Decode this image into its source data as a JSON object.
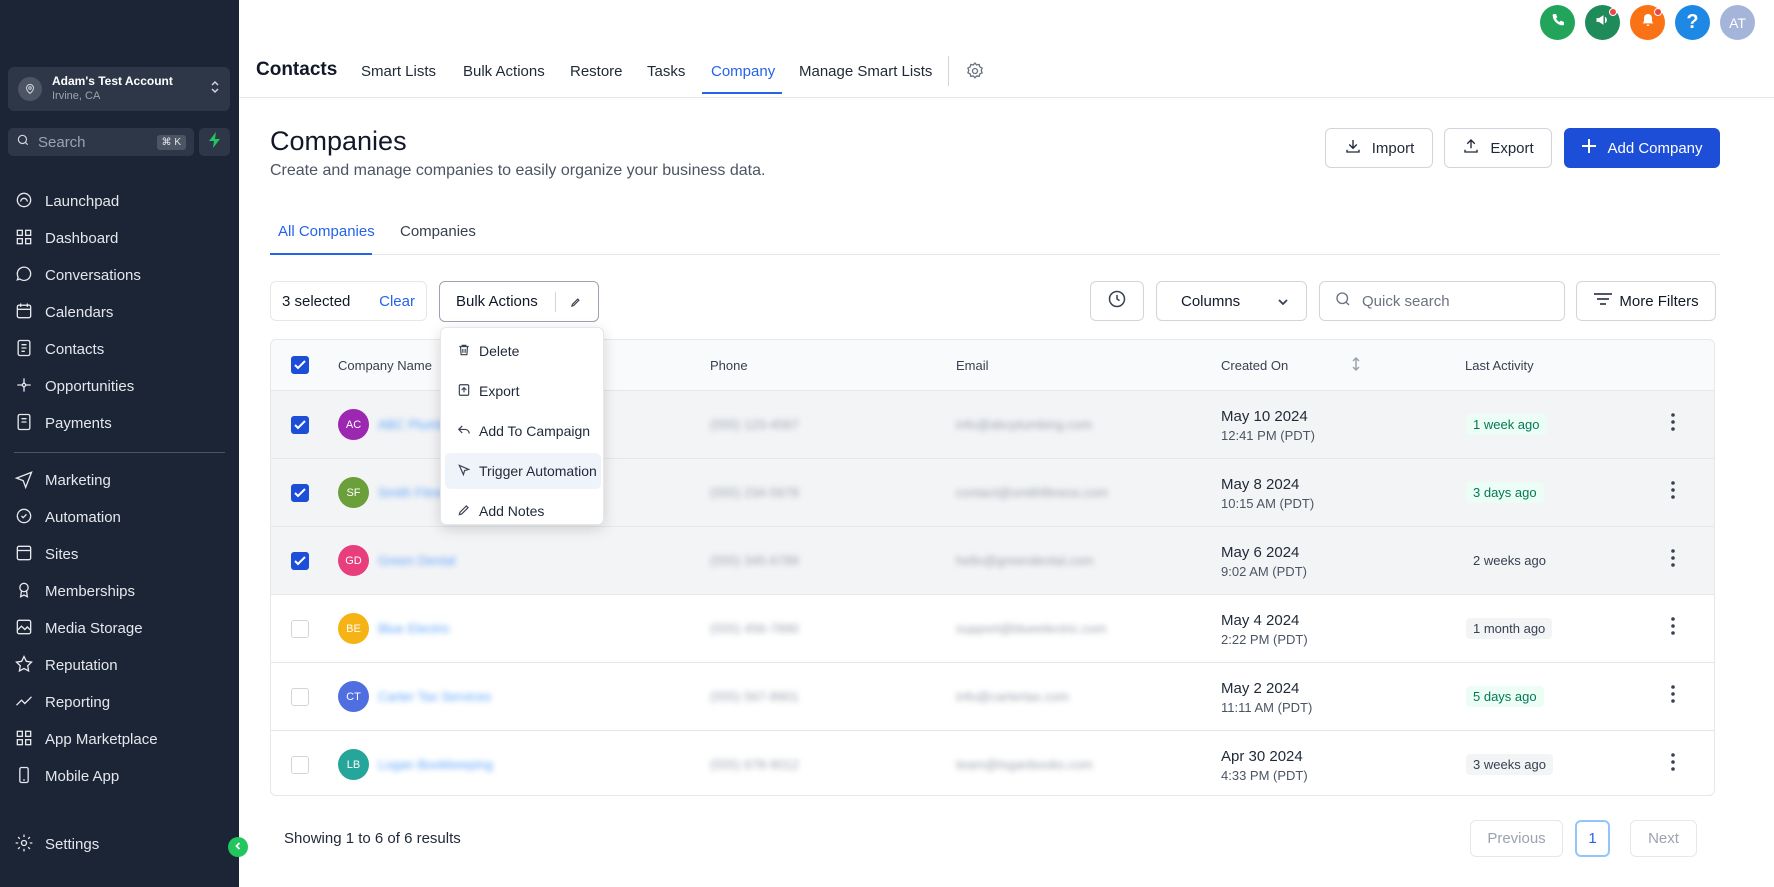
{
  "account": {
    "name": "Adam's Test Account",
    "location": "Irvine, CA"
  },
  "sidebar_search": {
    "placeholder": "Search",
    "shortcut": "⌘ K"
  },
  "sidebar": {
    "items": [
      {
        "label": "Launchpad",
        "icon": "launchpad-icon"
      },
      {
        "label": "Dashboard",
        "icon": "dashboard-icon"
      },
      {
        "label": "Conversations",
        "icon": "chat-icon"
      },
      {
        "label": "Calendars",
        "icon": "calendar-icon"
      },
      {
        "label": "Contacts",
        "icon": "contacts-icon"
      },
      {
        "label": "Opportunities",
        "icon": "opportunities-icon"
      },
      {
        "label": "Payments",
        "icon": "payments-icon"
      }
    ],
    "items2": [
      {
        "label": "Marketing",
        "icon": "send-icon"
      },
      {
        "label": "Automation",
        "icon": "automation-icon"
      },
      {
        "label": "Sites",
        "icon": "sites-icon"
      },
      {
        "label": "Memberships",
        "icon": "membership-icon"
      },
      {
        "label": "Media Storage",
        "icon": "image-icon"
      },
      {
        "label": "Reputation",
        "icon": "star-icon"
      },
      {
        "label": "Reporting",
        "icon": "chart-icon"
      },
      {
        "label": "App Marketplace",
        "icon": "grid-icon"
      },
      {
        "label": "Mobile App",
        "icon": "phone-icon"
      }
    ],
    "settings": "Settings"
  },
  "topnav": {
    "title": "Contacts",
    "tabs": [
      "Smart Lists",
      "Bulk Actions",
      "Restore",
      "Tasks",
      "Company",
      "Manage Smart Lists"
    ],
    "active_tab": "Company",
    "avatar": "AT"
  },
  "header": {
    "title": "Companies",
    "subtitle": "Create and manage companies to easily organize your business data.",
    "import": "Import",
    "export": "Export",
    "add": "Add Company"
  },
  "subtabs": [
    "All Companies",
    "Companies"
  ],
  "toolbar": {
    "selected": "3 selected",
    "clear": "Clear",
    "bulk": "Bulk Actions",
    "columns": "Columns",
    "search_placeholder": "Quick search",
    "more_filters": "More Filters"
  },
  "bulk_menu": [
    "Delete",
    "Export",
    "Add To Campaign",
    "Trigger Automation",
    "Add Notes"
  ],
  "table": {
    "headers": [
      "Company Name",
      "Phone",
      "Email",
      "Created On",
      "Last Activity"
    ],
    "rows": [
      {
        "initials": "AC",
        "color": "#9c27b0",
        "name": "ABC Plumbing",
        "phone": "(555) 123-4567",
        "email": "info@abcplumbing.com",
        "date": "May 10 2024",
        "time": "12:41 PM (PDT)",
        "activity": "1 week ago",
        "status": "green",
        "checked": true
      },
      {
        "initials": "SF",
        "color": "#6a9f3a",
        "name": "Smith Fitness",
        "phone": "(555) 234-5678",
        "email": "contact@smithfitness.com",
        "date": "May 8 2024",
        "time": "10:15 AM (PDT)",
        "activity": "3 days ago",
        "status": "green",
        "checked": true
      },
      {
        "initials": "GD",
        "color": "#e83e7c",
        "name": "Green Dental",
        "phone": "(555) 345-6789",
        "email": "hello@greendental.com",
        "date": "May 6 2024",
        "time": "9:02 AM (PDT)",
        "activity": "2 weeks ago",
        "status": "gray",
        "checked": true
      },
      {
        "initials": "BE",
        "color": "#f5b316",
        "name": "Blue Electric",
        "phone": "(555) 456-7890",
        "email": "support@blueelectric.com",
        "date": "May 4 2024",
        "time": "2:22 PM (PDT)",
        "activity": "1 month ago",
        "status": "gray",
        "checked": false
      },
      {
        "initials": "CT",
        "color": "#4f6fe0",
        "name": "Carter Tax Services",
        "phone": "(555) 567-8901",
        "email": "info@cartertax.com",
        "date": "May 2 2024",
        "time": "11:11 AM (PDT)",
        "activity": "5 days ago",
        "status": "green",
        "checked": false
      },
      {
        "initials": "LB",
        "color": "#26a69a",
        "name": "Logan Bookkeeping",
        "phone": "(555) 678-9012",
        "email": "team@loganbooks.com",
        "date": "Apr 30 2024",
        "time": "4:33 PM (PDT)",
        "activity": "3 weeks ago",
        "status": "gray",
        "checked": false
      }
    ]
  },
  "footer": {
    "showing": "Showing 1 to 6 of 6 results",
    "prev": "Previous",
    "page": "1",
    "next": "Next"
  },
  "colors": {
    "accent": "#1d4ed8",
    "sidebar": "#1c2536"
  }
}
